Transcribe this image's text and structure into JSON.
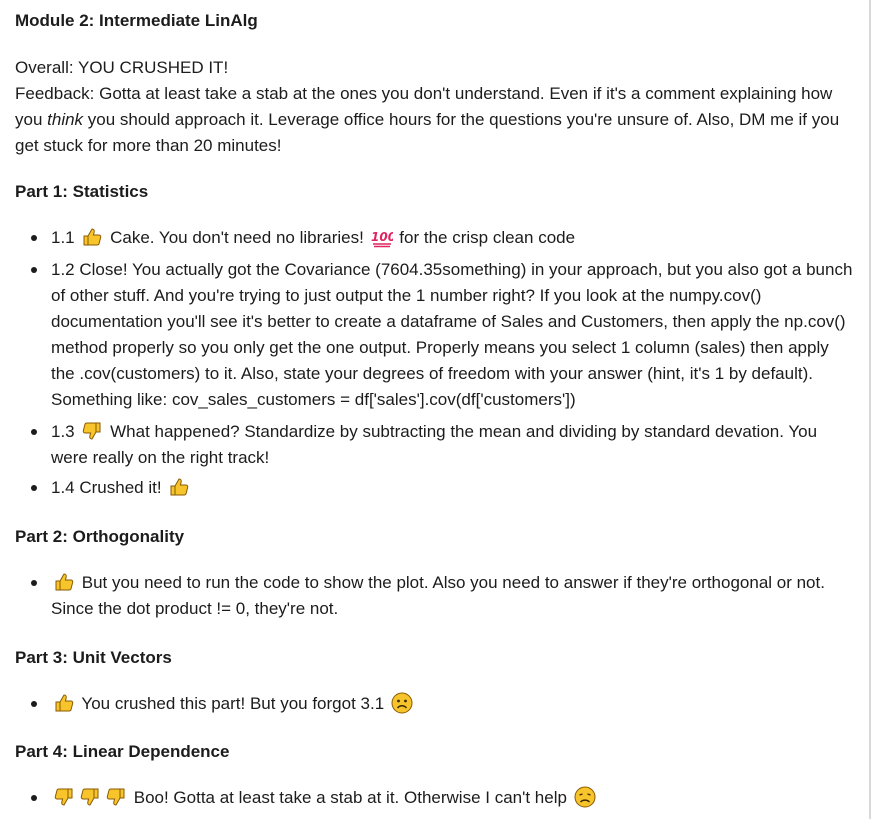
{
  "title": "Module 2: Intermediate LinAlg",
  "overall": "Overall: YOU CRUSHED IT!",
  "feedback": {
    "before": "Feedback: Gotta at least take a stab at the ones you don't understand. Even if it's a comment explaining how you ",
    "emph": "think",
    "after": " you should approach it. Leverage office hours for the questions you're unsure of. Also, DM me if you get stuck for more than 20 minutes!"
  },
  "parts": [
    {
      "heading": "Part 1: Statistics",
      "items": [
        {
          "prefix": "1.1",
          "icons": [
            "thumbs-up"
          ],
          "text": "Cake. You don't need no libraries!",
          "icon2": "hundred-points",
          "text2": "for the crisp clean code"
        },
        {
          "prefix": "",
          "icons": [],
          "text": "1.2 Close! You actually got the Covariance (7604.35something) in your approach, but you also got a bunch of other stuff. And you're trying to just output the 1 number right? If you look at the numpy.cov() documentation you'll see it's better to create a dataframe of Sales and Customers, then apply the np.cov() method properly so you only get the one output. Properly means you select 1 column (sales) then apply the .cov(customers) to it. Also, state your degrees of freedom with your answer (hint, it's 1 by default). Something like: cov_sales_customers = df['sales'].cov(df['customers'])"
        },
        {
          "prefix": "1.3",
          "icons": [
            "thumbs-down"
          ],
          "text": "What happened? Standardize by subtracting the mean and dividing by standard devation. You were really on the right track!"
        },
        {
          "prefix": "",
          "icons": [],
          "text": "1.4 Crushed it!",
          "icon2": "thumbs-up"
        }
      ]
    },
    {
      "heading": "Part 2: Orthogonality",
      "items": [
        {
          "prefix": "",
          "icons": [
            "thumbs-up"
          ],
          "text": "But you need to run the code to show the plot. Also you need to answer if they're orthogonal or not. Since the dot product != 0, they're not."
        }
      ]
    },
    {
      "heading": "Part 3: Unit Vectors",
      "items": [
        {
          "prefix": "",
          "icons": [
            "thumbs-up"
          ],
          "text": "You crushed this part! But you forgot 3.1",
          "icon2": "frowning-face"
        }
      ]
    },
    {
      "heading": "Part 4: Linear Dependence",
      "items": [
        {
          "prefix": "",
          "icons": [
            "thumbs-down",
            "thumbs-down",
            "thumbs-down"
          ],
          "text": "Boo! Gotta at least take a stab at it. Otherwise I can't help",
          "icon2": "disappointed-face"
        }
      ]
    }
  ],
  "colors": {
    "text": "#1d1c1d",
    "thumb": "#f7c52b",
    "hundred": "#e0245e",
    "face": "#f7c52b"
  }
}
